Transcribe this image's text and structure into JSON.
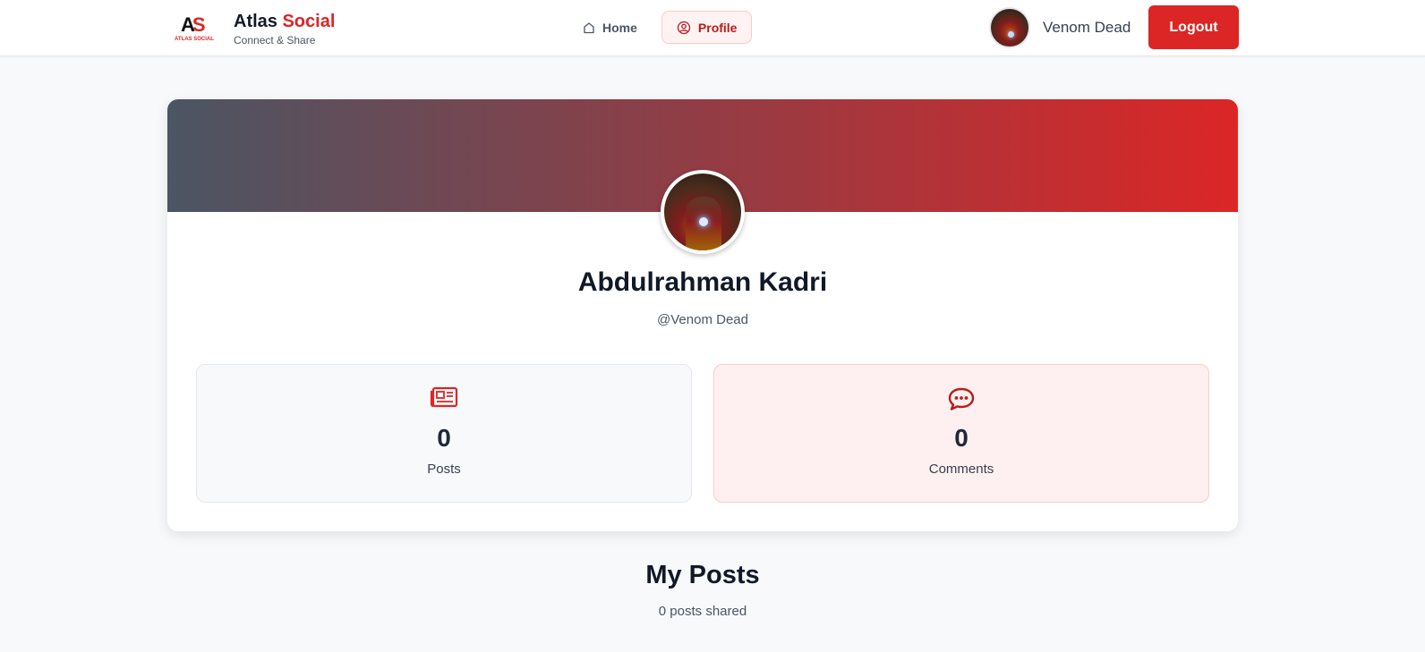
{
  "brand": {
    "logo_letters": "AS",
    "logo_caption": "ATLAS SOCIAL",
    "title_main": "Atlas",
    "title_accent": "Social",
    "tagline": "Connect & Share"
  },
  "nav": {
    "home_label": "Home",
    "profile_label": "Profile",
    "active": "Profile"
  },
  "user": {
    "display_name": "Venom Dead",
    "logout_label": "Logout"
  },
  "profile": {
    "full_name": "Abdulrahman Kadri",
    "handle": "@Venom Dead"
  },
  "stats": {
    "posts": {
      "value": "0",
      "label": "Posts",
      "icon": "newspaper-icon"
    },
    "comments": {
      "value": "0",
      "label": "Comments",
      "icon": "comment-dots-icon"
    }
  },
  "posts_section": {
    "title": "My Posts",
    "subtitle": "0 posts shared"
  },
  "colors": {
    "accent": "#dc2626",
    "cover_start": "#4b5563",
    "cover_end": "#dc2626",
    "page_bg": "#f8f9fb"
  }
}
